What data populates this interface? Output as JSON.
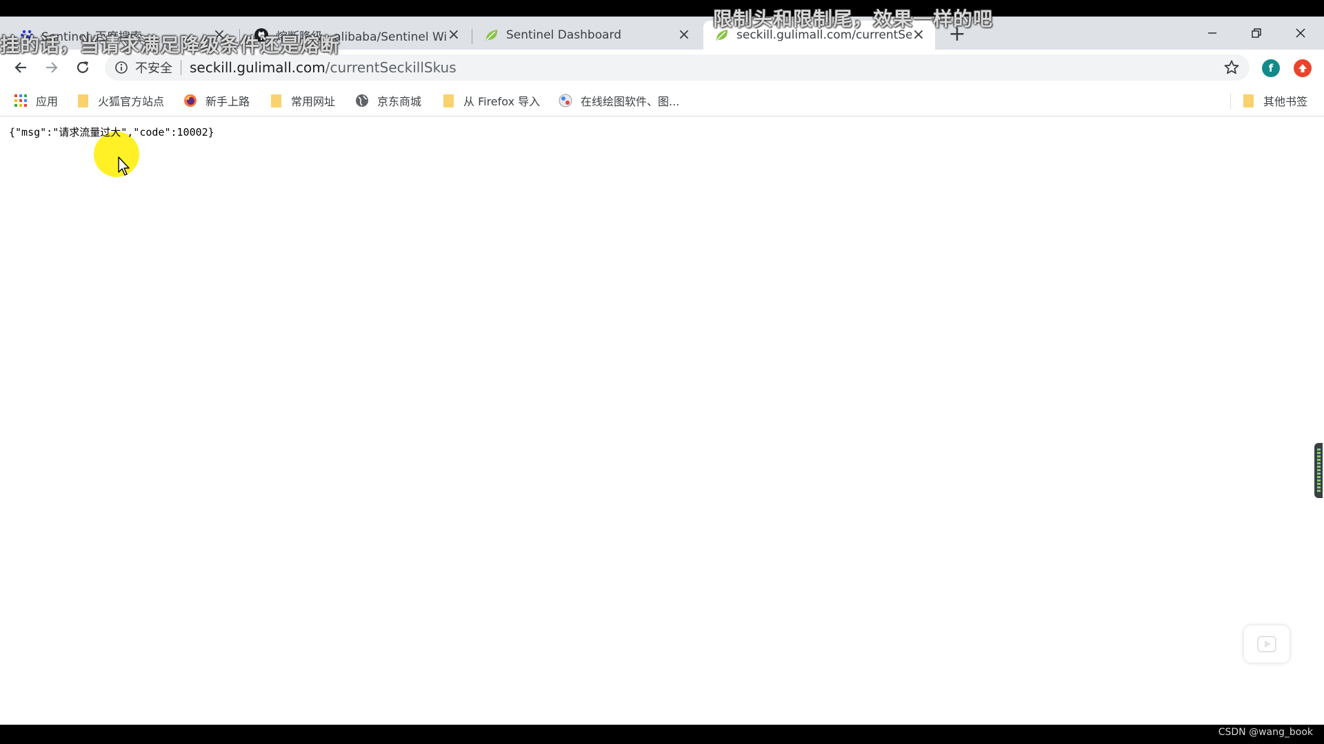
{
  "tabs": [
    {
      "title": "Sentinel_百度搜索",
      "icon": "paw-icon",
      "close": "×"
    },
    {
      "title": "熔断降级 · alibaba/Sentinel Wiki",
      "icon": "github-icon",
      "close": "×"
    },
    {
      "title": "Sentinel Dashboard",
      "icon": "leaf-icon",
      "close": "×"
    },
    {
      "title": "seckill.gulimall.com/currentSeckillSkus",
      "icon": "leaf-icon",
      "close": "×",
      "active": true
    }
  ],
  "new_tab": "+",
  "address_bar": {
    "security_label": "不安全",
    "url_host": "seckill.gulimall.com",
    "url_path": "/currentSeckillSkus"
  },
  "extensions": [
    {
      "letter": "f",
      "color": "#138a8a"
    },
    {
      "letter": "",
      "color": "#e8452c"
    }
  ],
  "bookmarks": [
    {
      "label": "应用",
      "icon": "apps-grid-icon"
    },
    {
      "label": "火狐官方站点",
      "icon": "folder-icon"
    },
    {
      "label": "新手上路",
      "icon": "firefox-icon"
    },
    {
      "label": "常用网址",
      "icon": "folder-icon"
    },
    {
      "label": "京东商城",
      "icon": "globe-icon"
    },
    {
      "label": "从 Firefox 导入",
      "icon": "folder-icon"
    },
    {
      "label": "在线绘图软件、图...",
      "icon": "drawing-app-icon"
    }
  ],
  "other_bookmarks": "其他书签",
  "page": {
    "json_response": "{\"msg\":\"请求流量过大\",\"code\":10002}"
  },
  "subtitles": {
    "line_top": "限制头和限制尾，效果一样的吧",
    "line_left": "挂的话，当请求满足降级条件还是熔断"
  },
  "credit": "CSDN @wang_book",
  "colors": {
    "tabstrip_bg": "#dee1e6",
    "omnibox_bg": "#f1f3f4",
    "cursor_highlight": "#ffee00",
    "leaf_green": "#8bc34a"
  }
}
